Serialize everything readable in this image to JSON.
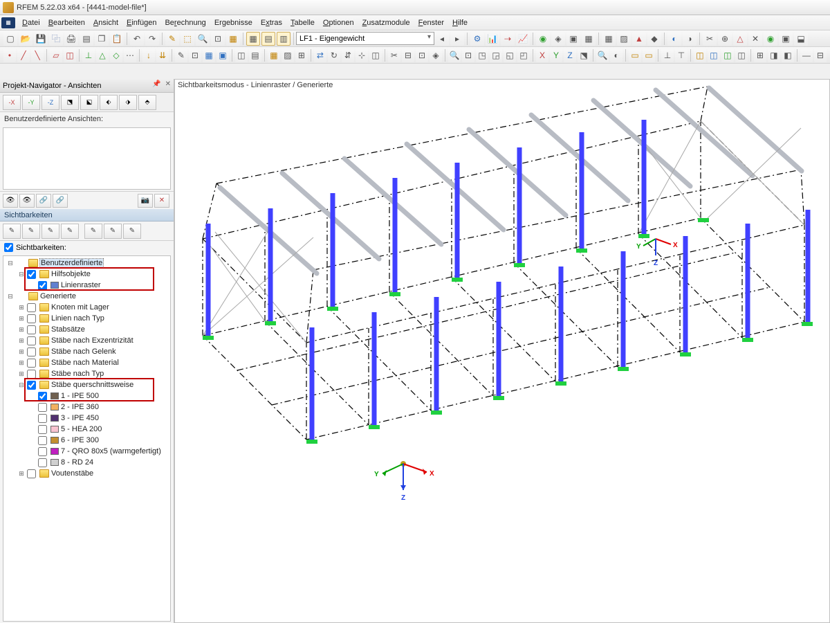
{
  "window": {
    "title": "RFEM 5.22.03 x64 - [4441-model-file*]"
  },
  "menu": [
    "Datei",
    "Bearbeiten",
    "Ansicht",
    "Einfügen",
    "Berechnung",
    "Ergebnisse",
    "Extras",
    "Tabelle",
    "Optionen",
    "Zusatzmodule",
    "Fenster",
    "Hilfe"
  ],
  "loadcase_combo": "LF1 - Eigengewicht",
  "navigator": {
    "title": "Projekt-Navigator - Ansichten",
    "userviews_label": "Benutzerdefinierte Ansichten:",
    "sichtbarkeiten_hdr": "Sichtbarkeiten",
    "sichtbarkeiten_cb": "Sichtbarkeiten:"
  },
  "tree": {
    "root1": "Benutzerdefinierte",
    "hilfs": "Hilfsobjekte",
    "linienraster": "Linienraster",
    "root2": "Generierte",
    "g_items": [
      "Knoten mit Lager",
      "Linien nach Typ",
      "Stabsätze",
      "Stäbe nach Exzentrizität",
      "Stäbe nach Gelenk",
      "Stäbe nach Material",
      "Stäbe nach Typ"
    ],
    "staebe_quer": "Stäbe querschnittsweise",
    "sections": [
      {
        "label": "1 - IPE 500",
        "color": "#706050",
        "checked": true
      },
      {
        "label": "2 - IPE 360",
        "color": "#f2b060",
        "checked": false
      },
      {
        "label": "3 - IPE 450",
        "color": "#503070",
        "checked": false
      },
      {
        "label": "5 - HEA 200",
        "color": "#f8c4d0",
        "checked": false
      },
      {
        "label": "6 - IPE 300",
        "color": "#c49030",
        "checked": false
      },
      {
        "label": "7 - QRO 80x5 (warmgefertigt)",
        "color": "#c020c0",
        "checked": false
      },
      {
        "label": "8 - RD 24",
        "color": "#d0d0d0",
        "checked": false
      }
    ],
    "vouten": "Voutenstäbe"
  },
  "viewport": {
    "label": "Sichtbarkeitsmodus - Linienraster / Generierte"
  },
  "axes": {
    "x": "X",
    "y": "Y",
    "z": "Z"
  }
}
